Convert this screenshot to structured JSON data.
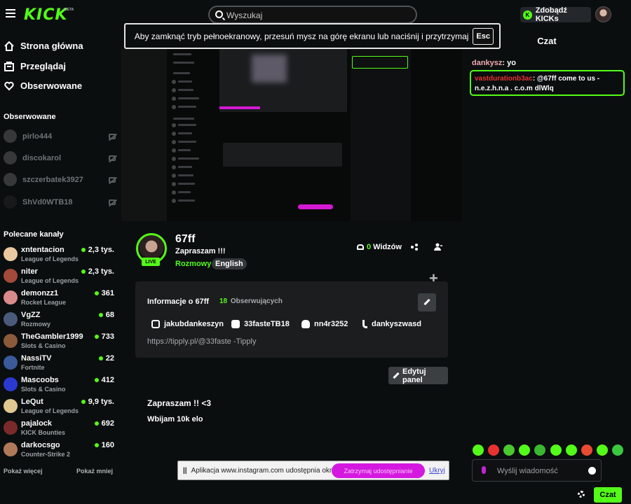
{
  "header": {
    "logo": "KICK",
    "beta": "BETA",
    "search_placeholder": "Wyszukaj",
    "kicks_button": "Zdobądź KICKs",
    "kicks_icon": "K"
  },
  "fullscreen_notice": {
    "text": "Aby zamknąć tryb pełnoekranowy, przesuń mysz na górę ekranu lub naciśnij i przytrzymaj",
    "key": "Esc"
  },
  "sidebar": {
    "nav": [
      {
        "label": "Strona główna",
        "icon": "home-icon"
      },
      {
        "label": "Przeglądaj",
        "icon": "browse-icon"
      },
      {
        "label": "Obserwowane",
        "icon": "heart-icon"
      }
    ],
    "followed_title": "Obserwowane",
    "followed": [
      {
        "name": "pirlo444"
      },
      {
        "name": "discokarol"
      },
      {
        "name": "szczerbatek3927"
      },
      {
        "name": "ShVd0WTB18"
      }
    ],
    "recommended_title": "Polecane kanały",
    "recommended": [
      {
        "name": "xntentacion",
        "category": "League of Legends",
        "viewers": "2,3 tys.",
        "color": "#e9c9a0"
      },
      {
        "name": "niter",
        "category": "League of Legends",
        "viewers": "2,3 tys.",
        "color": "#a34a3a"
      },
      {
        "name": "demonzz1",
        "category": "Rocket League",
        "viewers": "361",
        "color": "#d98b8b"
      },
      {
        "name": "VgZZ",
        "category": "Rozmowy",
        "viewers": "68",
        "color": "#4a5a7a"
      },
      {
        "name": "TheGambler1999",
        "category": "Slots & Casino",
        "viewers": "733",
        "color": "#8a5a3a"
      },
      {
        "name": "NassiTV",
        "category": "Fortnite",
        "viewers": "22",
        "color": "#3a5a9a"
      },
      {
        "name": "Mascoobs",
        "category": "Slots & Casino",
        "viewers": "412",
        "color": "#2a3ad0"
      },
      {
        "name": "LeQut",
        "category": "League of Legends",
        "viewers": "9,9 tys.",
        "color": "#e0c890"
      },
      {
        "name": "pajalock",
        "category": "KICK Bounties",
        "viewers": "692",
        "color": "#7a2a2a"
      },
      {
        "name": "darkocsgo",
        "category": "Counter-Strike 2",
        "viewers": "160",
        "color": "#b07a5a"
      }
    ],
    "show_more": "Pokaż więcej",
    "show_less": "Pokaż mniej"
  },
  "stream": {
    "channel": "67ff",
    "title": "Zapraszam !!!",
    "category": "Rozmowy",
    "tag": "English",
    "live_badge": "LIVE",
    "viewers_count": "0",
    "viewers_label": "Widzów"
  },
  "about": {
    "title": "Informacje o 67ff",
    "followers_count": "18",
    "followers_label": "Obserwujących",
    "socials": [
      {
        "icon": "instagram-icon",
        "label": "jakubdankeszyn"
      },
      {
        "icon": "youtube-icon",
        "label": "33fasteTB18"
      },
      {
        "icon": "discord-icon",
        "label": "nn4r3252"
      },
      {
        "icon": "tiktok-icon",
        "label": "dankyszwasd"
      }
    ],
    "link": "https://tipply.pl/@33faste -Tipply",
    "edit_panel": "Edytuj panel"
  },
  "panel": {
    "title": "Zapraszam !! <3",
    "body": "Wbijam 10k elo"
  },
  "screen_share": {
    "text": "Aplikacja www.instagram.com udostępnia okno.",
    "stop": "Zatrzymaj udostępnianie",
    "hide": "Ukryj"
  },
  "chat": {
    "title": "Czat",
    "messages": [
      {
        "user": "dankysz",
        "text": "yo"
      },
      {
        "user": "vastdurationb3ac",
        "text": "@67ff come to us - n.e.z.h.n.a . c.o.m dlWlq"
      }
    ],
    "input_placeholder": "Wyślij wiadomość",
    "send": "Czat"
  },
  "colors": {
    "accent": "#53fc18",
    "background": "#0b0e0f",
    "card": "#1b1d1f",
    "share_stop": "#d418e0"
  }
}
